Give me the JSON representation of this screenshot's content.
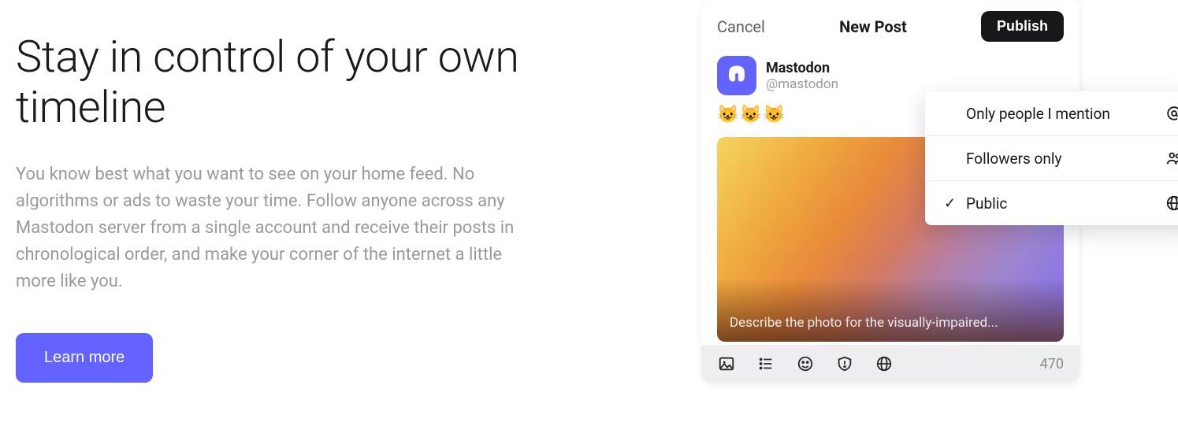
{
  "hero": {
    "headline": "Stay in control of your own timeline",
    "body": "You know best what you want to see on your home feed. No algorithms or ads to waste your time. Follow anyone across any Mastodon server from a single account and receive their posts in chronological order, and make your corner of the internet a little more like you.",
    "cta_label": "Learn more"
  },
  "compose": {
    "cancel_label": "Cancel",
    "title": "New Post",
    "publish_label": "Publish",
    "author_name": "Mastodon",
    "author_handle": "@mastodon",
    "post_text": "😺😺😺",
    "alt_prompt": "Describe the photo for the visually-impaired...",
    "char_count": "470"
  },
  "visibility_options": [
    {
      "label": "Only people I mention",
      "icon": "at",
      "selected": false
    },
    {
      "label": "Followers only",
      "icon": "followers",
      "selected": false
    },
    {
      "label": "Public",
      "icon": "globe",
      "selected": true
    }
  ],
  "footer_icons": [
    "image",
    "poll",
    "emoji",
    "cw",
    "globe"
  ]
}
